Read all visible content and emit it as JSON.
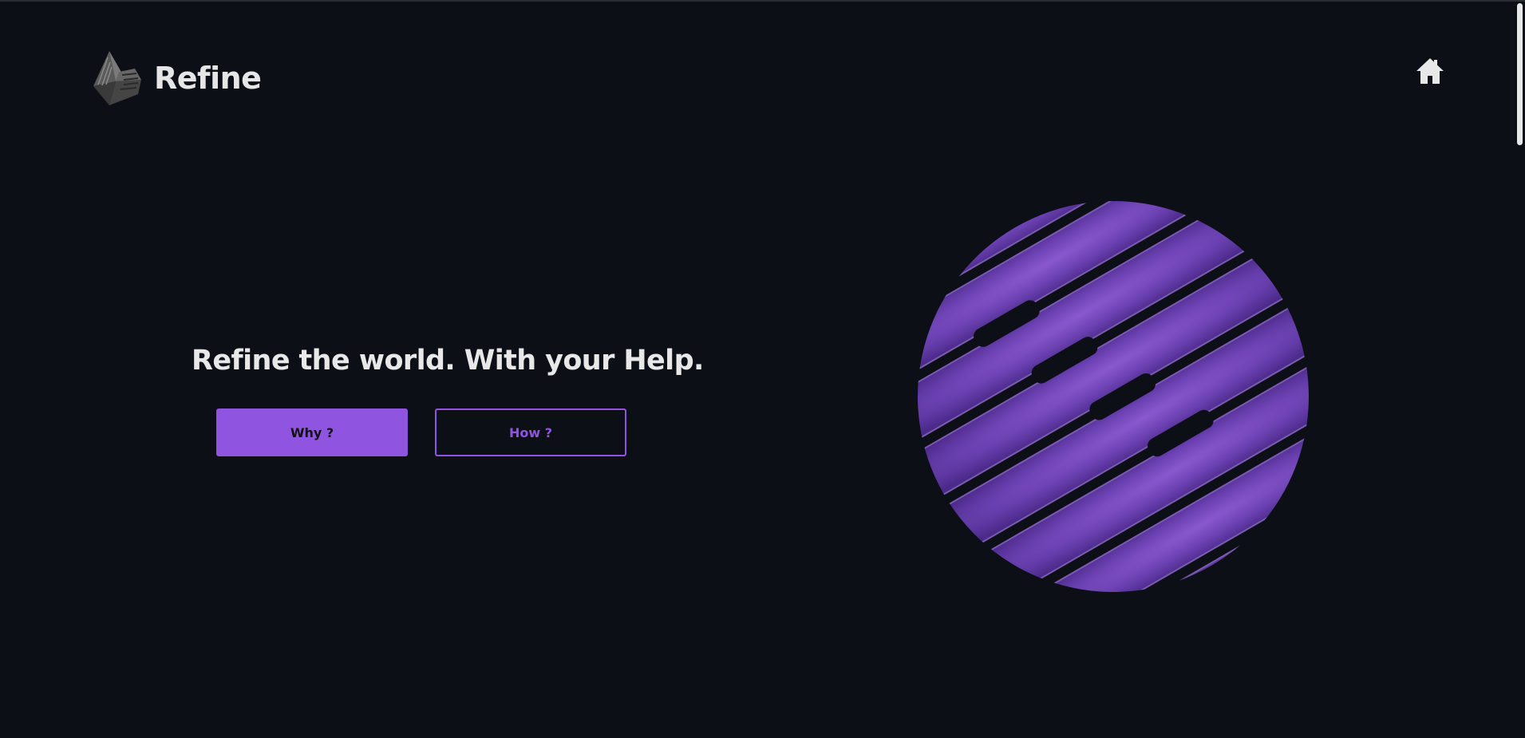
{
  "header": {
    "brand_name": "Refine",
    "logo_icon": "paper-plane-logo-icon",
    "home_icon": "home-icon"
  },
  "hero": {
    "title": "Refine the world. With your Help.",
    "buttons": {
      "why_label": "Why ?",
      "how_label": "How ?"
    },
    "illustration_icon": "striped-sphere-icon"
  },
  "colors": {
    "background": "#0c0f16",
    "accent": "#8f55e0",
    "text": "#e8e8e8"
  }
}
